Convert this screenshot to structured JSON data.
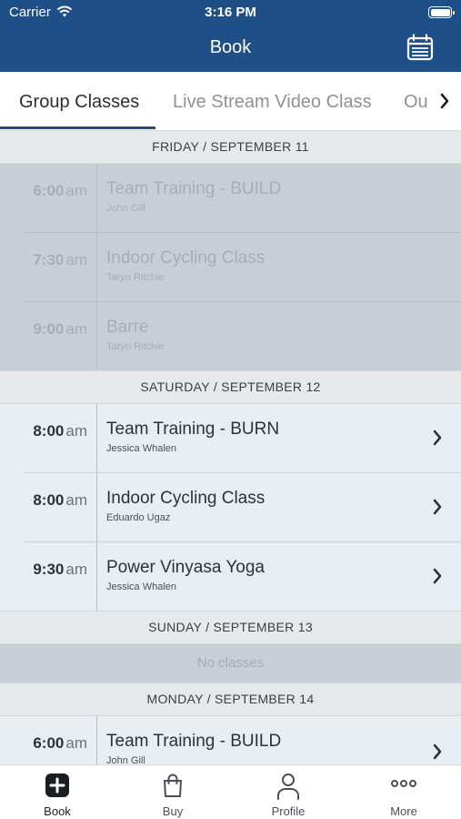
{
  "status_bar": {
    "carrier": "Carrier",
    "time": "3:16 PM"
  },
  "header": {
    "title": "Book",
    "calendar_icon": "calendar-icon"
  },
  "tabs": [
    {
      "label": "Group Classes",
      "active": true
    },
    {
      "label": "Live Stream Video Class",
      "active": false
    },
    {
      "label": "Ou",
      "active": false
    }
  ],
  "days": [
    {
      "label": "FRIDAY / SEPTEMBER 11",
      "past": true,
      "classes": [
        {
          "time": "6:00",
          "ampm": "am",
          "name": "Team Training - BUILD",
          "instructor": "John Gill"
        },
        {
          "time": "7:30",
          "ampm": "am",
          "name": "Indoor Cycling Class",
          "instructor": "Taryn Ritchie"
        },
        {
          "time": "9:00",
          "ampm": "am",
          "name": "Barre",
          "instructor": "Taryn Ritchie"
        }
      ]
    },
    {
      "label": "SATURDAY / SEPTEMBER 12",
      "past": false,
      "classes": [
        {
          "time": "8:00",
          "ampm": "am",
          "name": "Team Training - BURN",
          "instructor": "Jessica Whalen"
        },
        {
          "time": "8:00",
          "ampm": "am",
          "name": "Indoor Cycling Class",
          "instructor": "Eduardo Ugaz"
        },
        {
          "time": "9:30",
          "ampm": "am",
          "name": "Power Vinyasa Yoga",
          "instructor": "Jessica Whalen"
        }
      ]
    },
    {
      "label": "SUNDAY / SEPTEMBER 13",
      "no_classes": "No classes"
    },
    {
      "label": "MONDAY / SEPTEMBER 14",
      "past": false,
      "classes": [
        {
          "time": "6:00",
          "ampm": "am",
          "name": "Team Training - BUILD",
          "instructor": "John Gill"
        }
      ]
    }
  ],
  "tabbar": [
    {
      "label": "Book",
      "icon": "plus-square-icon",
      "active": true
    },
    {
      "label": "Buy",
      "icon": "shopping-bag-icon",
      "active": false
    },
    {
      "label": "Profile",
      "icon": "person-icon",
      "active": false
    },
    {
      "label": "More",
      "icon": "more-dots-icon",
      "active": false
    }
  ],
  "colors": {
    "header": "#1f4f87",
    "accent": "#1f4f87",
    "past_block": "#c7ced6"
  }
}
